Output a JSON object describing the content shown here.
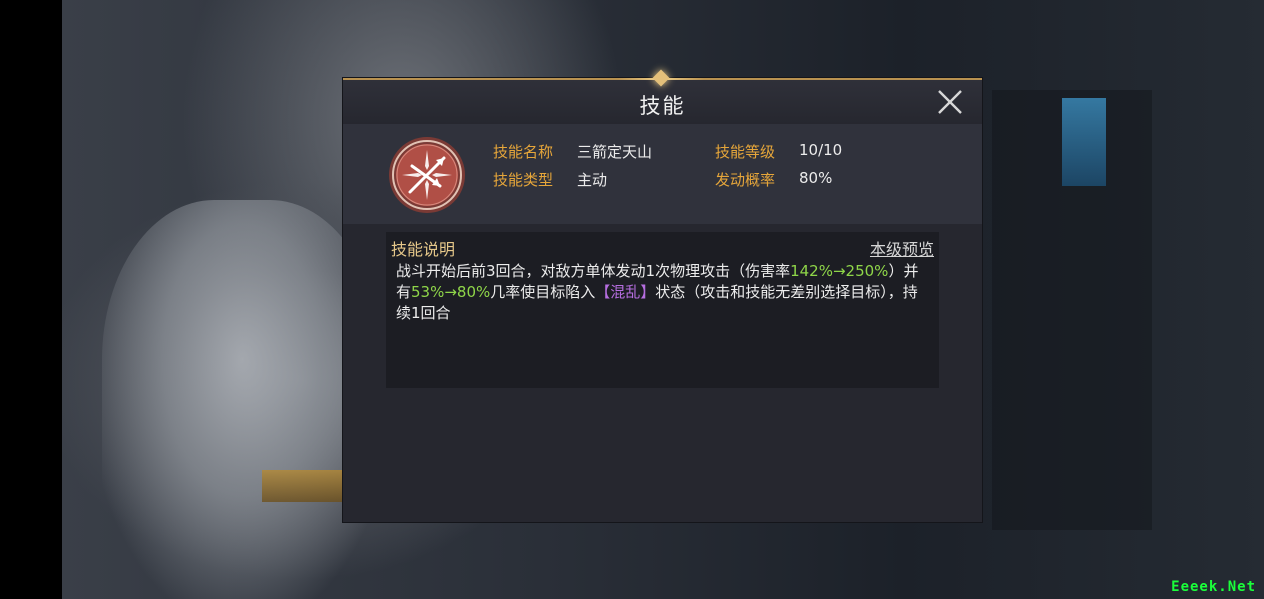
{
  "dialog": {
    "title": "技能",
    "close_icon": "close-icon"
  },
  "skill": {
    "icon": "crossed-arrows-skill-icon",
    "name_label": "技能名称",
    "name_value": "三箭定天山",
    "level_label": "技能等级",
    "level_value": "10/10",
    "type_label": "技能类型",
    "type_value": "主动",
    "trigger_label": "发动概率",
    "trigger_value": "80%"
  },
  "description": {
    "title": "技能说明",
    "preview_link": "本级预览",
    "segments": [
      {
        "text": "战斗开始后前3回合，对敌方单体发动1次物理攻击（伤害率",
        "color": "default"
      },
      {
        "text": "142%→250%",
        "color": "green"
      },
      {
        "text": "）并有",
        "color": "default"
      },
      {
        "text": "53%→80%",
        "color": "green"
      },
      {
        "text": "几率使目标陷入",
        "color": "default"
      },
      {
        "text": "【混乱】",
        "color": "purple"
      },
      {
        "text": "状态（攻击和技能无差别选择目标），持续1回合",
        "color": "default"
      }
    ]
  },
  "watermark": "Eeeek.Net",
  "colors": {
    "label_gold": "#e6a63a",
    "highlight_green": "#8fd649",
    "status_purple": "#b66ee0",
    "panel_border": "#b99250"
  }
}
